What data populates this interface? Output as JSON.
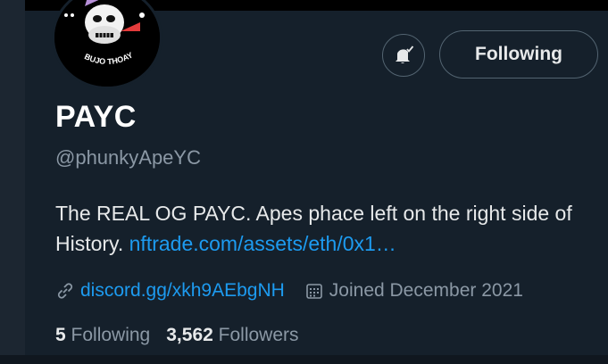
{
  "profile": {
    "name": "PAYC",
    "handle": "@phunkyApeYC",
    "bio_text": "The REAL OG PAYC. Apes phace left on the right side of History. ",
    "bio_link": "nftrade.com/assets/eth/0x1…",
    "website": "discord.gg/xkh9AEbgNH",
    "joined": "Joined December 2021",
    "avatar_text": "BUJO THOAY"
  },
  "stats": {
    "following_count": "5",
    "following_label": "Following",
    "followers_count": "3,562",
    "followers_label": "Followers"
  },
  "actions": {
    "follow_label": "Following",
    "notify_icon": "bell-check-icon"
  },
  "colors": {
    "background": "#15202b",
    "link": "#1d9bf0",
    "muted": "#8b98a5"
  }
}
